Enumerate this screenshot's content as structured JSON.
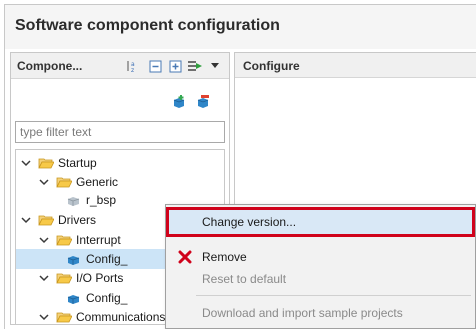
{
  "dialog": {
    "title": "Software component configuration"
  },
  "left_panel": {
    "header_label": "Compone...",
    "filter_placeholder": "type filter text",
    "toolbar_icons": [
      "sort-az-icon",
      "collapse-all-icon",
      "expand-all-icon",
      "view-menu-icon",
      "dropdown-arrow-icon"
    ],
    "action_icons": [
      "add-component-icon",
      "remove-component-icon"
    ]
  },
  "tree": {
    "startup": "Startup",
    "generic": "Generic",
    "r_bsp": "r_bsp",
    "drivers": "Drivers",
    "interrupt": "Interrupt",
    "config_1": "Config_",
    "io_ports": "I/O Ports",
    "config_2": "Config_",
    "communications": "Communications"
  },
  "right_panel": {
    "header_label": "Configure"
  },
  "context_menu": {
    "change_version": "Change version...",
    "remove": "Remove",
    "reset_default": "Reset to default",
    "download_samples": "Download and import sample projects"
  },
  "colors": {
    "highlight_border": "#d0021b",
    "selection": "#cce4f7",
    "folder": "#e8b53a",
    "chevron": "#3a3a3a"
  }
}
